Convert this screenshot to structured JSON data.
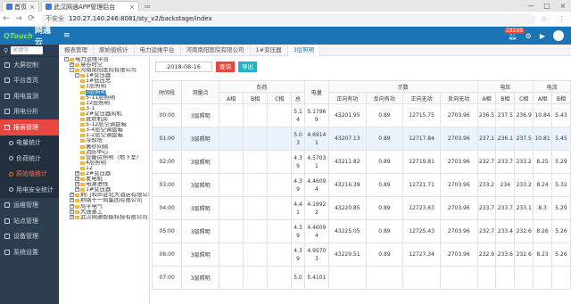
{
  "browser": {
    "tabs": [
      {
        "label": "首页"
      },
      {
        "label": "武汉网通APP管理后台"
      },
      {
        "label": ""
      }
    ],
    "back": "←",
    "forward": "→",
    "reload": "⟳",
    "security": "不安全",
    "url": "120.27.140.246:8081/sty_v2/backstage/index",
    "star": "☆",
    "menu": "⋮"
  },
  "header": {
    "logo_en": "QTouch",
    "logo_cn": "网通云",
    "badge": "28299",
    "icons": [
      "bell-icon",
      "settings-icon",
      "play-icon"
    ]
  },
  "sidebar": {
    "search_placeholder": "关键字",
    "items": [
      {
        "label": "大屏控制"
      },
      {
        "label": "平台首页"
      },
      {
        "label": "用电监测"
      },
      {
        "label": "用电分析"
      },
      {
        "label": "报表管理"
      }
    ],
    "subitems": [
      {
        "label": "电量统计"
      },
      {
        "label": "负荷统计"
      },
      {
        "label": "原始值统计"
      },
      {
        "label": "用电安全统计"
      }
    ],
    "items2": [
      {
        "label": "运维管理"
      },
      {
        "label": "站点管理"
      },
      {
        "label": "设备管理"
      },
      {
        "label": "系统设置"
      }
    ]
  },
  "tabs": [
    {
      "label": "报表管理"
    },
    {
      "label": "原始值统计"
    },
    {
      "label": "电力运维平台"
    },
    {
      "label": "河南南阳医院有限公司"
    },
    {
      "label": "1#变压器"
    },
    {
      "label": "3层照明"
    }
  ],
  "tree": [
    {
      "label": "电力运维平台",
      "pm": "⊟",
      "lv": 0
    },
    {
      "label": "慧谷时空",
      "pm": "⊞",
      "lv": 1
    },
    {
      "label": "河南南阳医院有限公司",
      "pm": "⊟",
      "lv": 1
    },
    {
      "label": "1#变压器",
      "pm": "⊟",
      "lv": 2
    },
    {
      "label": "1#低压总",
      "pm": "",
      "lv": 3
    },
    {
      "label": "1层照明",
      "pm": "",
      "lv": 3
    },
    {
      "label": "3层照明",
      "pm": "",
      "lv": 3
    },
    {
      "label": "5-11层照明",
      "pm": "",
      "lv": 3
    },
    {
      "label": "12层照明",
      "pm": "",
      "lv": 3
    },
    {
      "label": "3-1",
      "pm": "",
      "lv": 3
    },
    {
      "label": "2#变压器风机",
      "pm": "",
      "lv": 3
    },
    {
      "label": "直燃机房",
      "pm": "",
      "lv": 3
    },
    {
      "label": "5-12层空调盘箱",
      "pm": "",
      "lv": 3
    },
    {
      "label": "3-4层空调盘箱",
      "pm": "",
      "lv": 3
    },
    {
      "label": "1-2层空调盘箱",
      "pm": "",
      "lv": 3
    },
    {
      "label": "冷却塔",
      "pm": "",
      "lv": 3
    },
    {
      "label": "裹纱间隔",
      "pm": "",
      "lv": 3
    },
    {
      "label": "消防中心",
      "pm": "",
      "lv": 3
    },
    {
      "label": "设备房照明（地下室）",
      "pm": "",
      "lv": 3
    },
    {
      "label": "4层照明",
      "pm": "",
      "lv": 3
    },
    {
      "label": "12",
      "pm": "",
      "lv": 3
    },
    {
      "label": "2#变压器",
      "pm": "⊞",
      "lv": 2
    },
    {
      "label": "发电机",
      "pm": "⊞",
      "lv": 2
    },
    {
      "label": "电源进线",
      "pm": "⊞",
      "lv": 2
    },
    {
      "label": "1#变压器",
      "pm": "⊞",
      "lv": 2
    },
    {
      "label": "荆门和声驻北大酒店有限公司",
      "pm": "⊞",
      "lv": 1
    },
    {
      "label": "荆钢十一局集团有限公司",
      "pm": "⊞",
      "lv": 1
    },
    {
      "label": "局平电气",
      "pm": "⊞",
      "lv": 1
    },
    {
      "label": "大连重工",
      "pm": "⊞",
      "lv": 1
    },
    {
      "label": "武汉网通智能科技有限公司",
      "pm": "⊞",
      "lv": 1
    }
  ],
  "filter": {
    "date": "2018-08-16",
    "query": "查询",
    "export": "导出"
  },
  "table": {
    "h1": [
      "时间段",
      "测量点",
      "负荷",
      "电量",
      "示数",
      "电压",
      "电流"
    ],
    "h2": [
      "A相",
      "B相",
      "C相",
      "总",
      "正向有功",
      "反向有功",
      "正向无功",
      "反向无功",
      "A相",
      "B相",
      "C相",
      "A相",
      "B相"
    ],
    "rows": [
      {
        "t": "00:00",
        "p": "3层照明",
        "a": "",
        "b": "",
        "c": "",
        "z": "5.1 4",
        "e": "5.1796 9",
        "f1": "43201.95",
        "f2": "0.89",
        "f3": "12715.75",
        "f4": "2703.96",
        "va": "236.5",
        "vb": "237.5",
        "vc": "236.9",
        "ia": "10.84",
        "ib": "5.43"
      },
      {
        "t": "01:00",
        "p": "3层照明",
        "a": "",
        "b": "",
        "c": "",
        "z": "5.0 3",
        "e": "4.6914 1",
        "f1": "43207.13",
        "f2": "0.89",
        "f3": "12717.84",
        "f4": "2703.96",
        "va": "237.1",
        "vb": "236.1",
        "vc": "237.5",
        "ia": "10.81",
        "ib": "5.45"
      },
      {
        "t": "02:00",
        "p": "3层照明",
        "a": "",
        "b": "",
        "c": "",
        "z": "4.3 9",
        "e": "4.5703 1",
        "f1": "43211.82",
        "f2": "0.89",
        "f3": "12719.81",
        "f4": "2703.96",
        "va": "232.7",
        "vb": "233.7",
        "vc": "233.2",
        "ia": "8.25",
        "ib": "5.29"
      },
      {
        "t": "03:00",
        "p": "3层照明",
        "a": "",
        "b": "",
        "c": "",
        "z": "4.3 9",
        "e": "4.4609 4",
        "f1": "43216.39",
        "f2": "0.89",
        "f3": "12721.71",
        "f4": "2703.96",
        "va": "233.2",
        "vb": "234",
        "vc": "233.2",
        "ia": "8.24",
        "ib": "5.32"
      },
      {
        "t": "04:00",
        "p": "3层照明",
        "a": "",
        "b": "",
        "c": "",
        "z": "4.4 1",
        "e": "4.1992 2",
        "f1": "43220.85",
        "f2": "0.89",
        "f3": "12723.63",
        "f4": "2703.96",
        "va": "233.7",
        "vb": "233.7",
        "vc": "233.1",
        "ia": "8.3",
        "ib": "5.29"
      },
      {
        "t": "05:00",
        "p": "3层照明",
        "a": "",
        "b": "",
        "c": "",
        "z": "4.3 9",
        "e": "4.4609 4",
        "f1": "43225.05",
        "f2": "0.89",
        "f3": "12725.43",
        "f4": "2703.96",
        "va": "232.7",
        "vb": "233.4",
        "vc": "232.6",
        "ia": "8.26",
        "ib": "5.26"
      },
      {
        "t": "06:00",
        "p": "3层照明",
        "a": "",
        "b": "",
        "c": "",
        "z": "4.3 9",
        "e": "4.9570 3",
        "f1": "43229.51",
        "f2": "0.89",
        "f3": "12727.34",
        "f4": "2703.96",
        "va": "232.9",
        "vb": "233.6",
        "vc": "232.6",
        "ia": "8.23",
        "ib": "5.26"
      },
      {
        "t": "07:00",
        "p": "3层照明",
        "a": "",
        "b": "",
        "c": "",
        "z": "5.0",
        "e": "5.4101",
        "f1": "",
        "f2": "",
        "f3": "",
        "f4": "",
        "va": "",
        "vb": "",
        "vc": "",
        "ia": "",
        "ib": ""
      }
    ]
  },
  "colors": {
    "header": "#1b74b3",
    "sidebar": "#2d3e50",
    "active": "#e8473f",
    "export": "#1fb5c2"
  }
}
